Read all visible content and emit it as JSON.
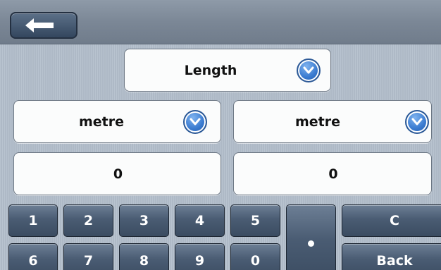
{
  "header": {
    "back_icon": "left-arrow-icon"
  },
  "category": {
    "label": "Length",
    "icon": "chevron-down-icon"
  },
  "from_unit": {
    "label": "metre",
    "icon": "chevron-down-icon"
  },
  "to_unit": {
    "label": "metre",
    "icon": "chevron-down-icon"
  },
  "from_value": "0",
  "to_value": "0",
  "keypad": {
    "k1": "1",
    "k2": "2",
    "k3": "3",
    "k4": "4",
    "k5": "5",
    "k6": "6",
    "k7": "7",
    "k8": "8",
    "k9": "9",
    "k0": "0",
    "clear": "C",
    "back": "Back"
  },
  "colors": {
    "accent": "#3a7bd0",
    "key": "#4a5c73",
    "header": "#7b8796"
  }
}
